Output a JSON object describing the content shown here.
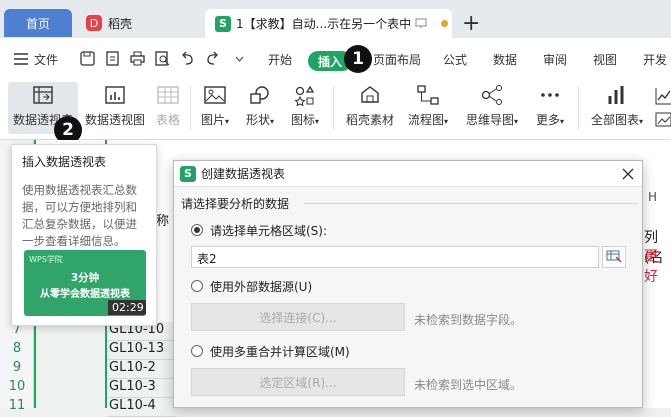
{
  "tabs": {
    "home": "首页",
    "daoke": "稻壳",
    "doc": "1【求教】自动...示在另一个表中",
    "add": "+"
  },
  "menu": {
    "file": "文件",
    "items": [
      "开始",
      "插入",
      "页面布局",
      "公式",
      "数据",
      "审阅",
      "视图",
      "开发"
    ]
  },
  "badges": {
    "one": "1",
    "two": "2"
  },
  "ribbon": {
    "pivot_table": "数据透视表",
    "pivot_chart": "数据透视图",
    "table": "表格",
    "picture": "图片",
    "shape": "形状",
    "icon": "图标",
    "daoke_material": "稻壳素材",
    "flowchart": "流程图",
    "mindmap": "思维导图",
    "more": "更多",
    "all_charts": "全部图表"
  },
  "tooltip": {
    "title": "插入数据透视表",
    "desc": "使用数据透视表汇总数据，可以方便地排列和汇总复杂数据，以便进一步查看详细信息。",
    "video_logo": "WPS学院",
    "video_line1": "3分钟",
    "video_line2": "从零学会数据透视表",
    "video_time": "02:29"
  },
  "sheet": {
    "rows": [
      {
        "num": "7",
        "val": "GL10-10"
      },
      {
        "num": "8",
        "val": "GL10-13"
      },
      {
        "num": "9",
        "val": "GL10-2"
      },
      {
        "num": "10",
        "val": "GL10-3"
      },
      {
        "num": "11",
        "val": "GL10-4"
      }
    ],
    "partial_header": "称",
    "col_h": "H",
    "right_text1": "列(名",
    "right_text2": "更好"
  },
  "dialog": {
    "title": "创建数据透视表",
    "section": "请选择要分析的数据",
    "opt1": "请选择单元格区域(S):",
    "range_value": "表2",
    "opt2": "使用外部数据源(U)",
    "btn_connect": "选择连接(C)...",
    "hint_connect": "未检索到数据字段。",
    "opt3": "使用多重合并计算区域(M)",
    "btn_range": "选定区域(R)...",
    "hint_range": "未检索到选中区域。"
  }
}
